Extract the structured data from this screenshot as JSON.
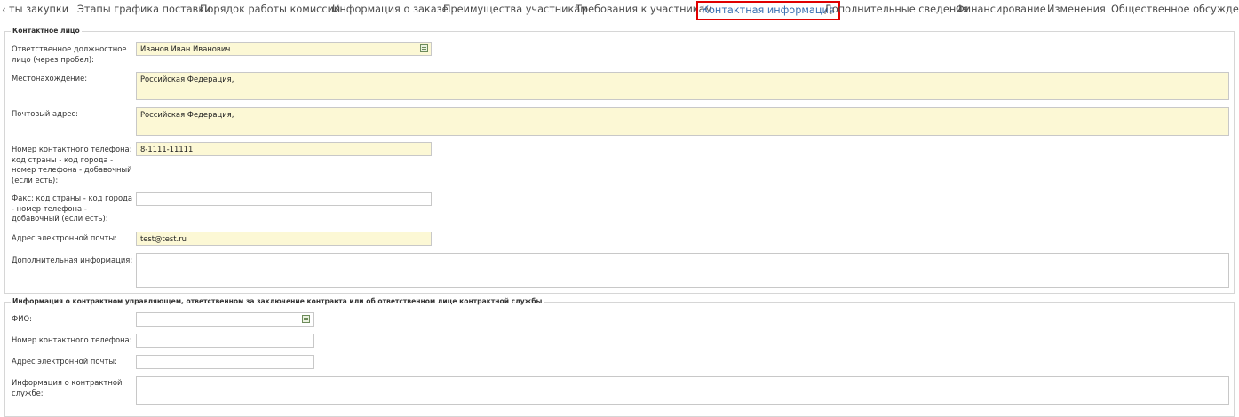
{
  "tabs": [
    {
      "label": "ты закупки"
    },
    {
      "label": "Этапы графика поставки"
    },
    {
      "label": "Порядок работы комиссии"
    },
    {
      "label": "Информация о заказе"
    },
    {
      "label": "Преимущества участникам"
    },
    {
      "label": "Требования к участникам"
    },
    {
      "label": "Контактная информация",
      "active": true
    },
    {
      "label": "Дополнительные сведения"
    },
    {
      "label": "Финансирование"
    },
    {
      "label": "Изменения"
    },
    {
      "label": "Общественное обсуждение"
    }
  ],
  "contact": {
    "legend": "Контактное лицо",
    "responsible_label": "Ответственное должностное лицо (через пробел):",
    "responsible_value": "Иванов Иван Иванович",
    "location_label": "Местонахождение:",
    "location_value": "Российская Федерация,",
    "postal_label": "Почтовый адрес:",
    "postal_value": "Российская Федерация,",
    "phone_label": "Номер контактного телефона: код страны - код города - номер телефона - добавочный (если есть):",
    "phone_value": "8-1111-11111",
    "fax_label": "Факс: код страны - код города - номер телефона - добавочный (если есть):",
    "fax_value": "",
    "email_label": "Адрес электронной почты:",
    "email_value": "test@test.ru",
    "additional_label": "Дополнительная информация:",
    "additional_value": ""
  },
  "contract_manager": {
    "legend": "Информация о контрактном управляющем, ответственном за заключение контракта или об ответственном лице контрактной службы",
    "fio_label": "ФИО:",
    "fio_value": "",
    "phone_label": "Номер контактного телефона:",
    "phone_value": "",
    "email_label": "Адрес электронной почты:",
    "email_value": "",
    "service_label": "Информация о контрактной службе:",
    "service_value": ""
  },
  "colors": {
    "active_tab_border": "#e00000",
    "filled_field_bg": "#fcf8d5"
  },
  "icons": {
    "tab_scroll_left": "chevron-left-icon",
    "lookup": "lookup-list-icon"
  }
}
